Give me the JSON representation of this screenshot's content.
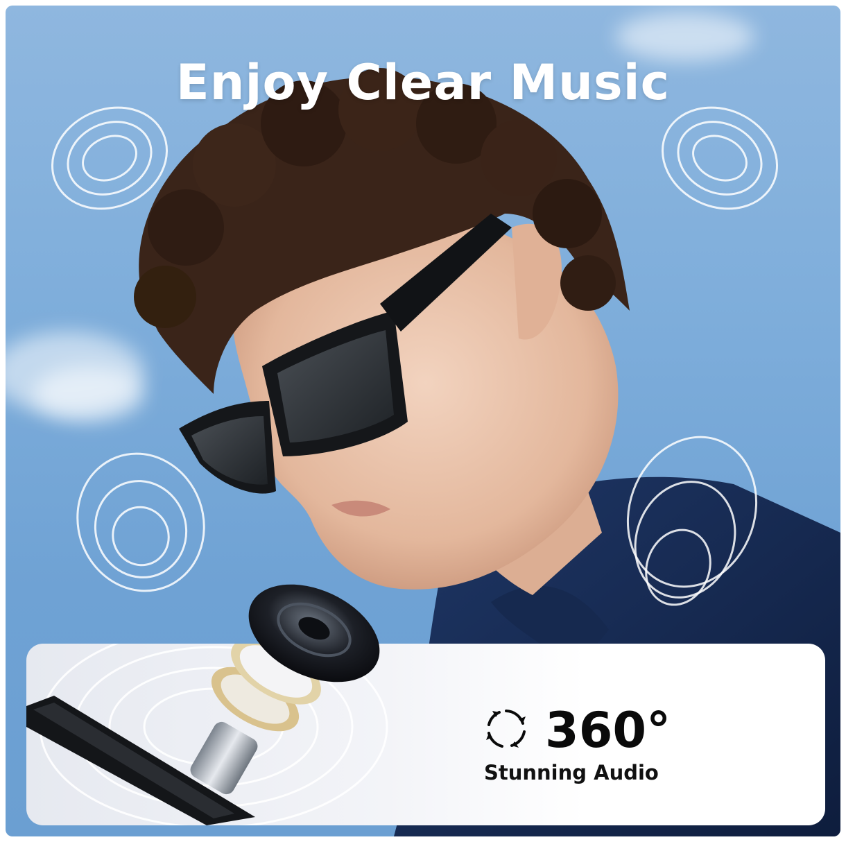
{
  "headline": "Enjoy Clear Music",
  "feature": {
    "value": "360°",
    "caption": "Stunning Audio",
    "icon": "rotate-360-icon"
  },
  "colors": {
    "sky": "#7faedb",
    "panel": "#f3f4f8",
    "text_dark": "#0a0a0a",
    "text_light": "#ffffff"
  }
}
